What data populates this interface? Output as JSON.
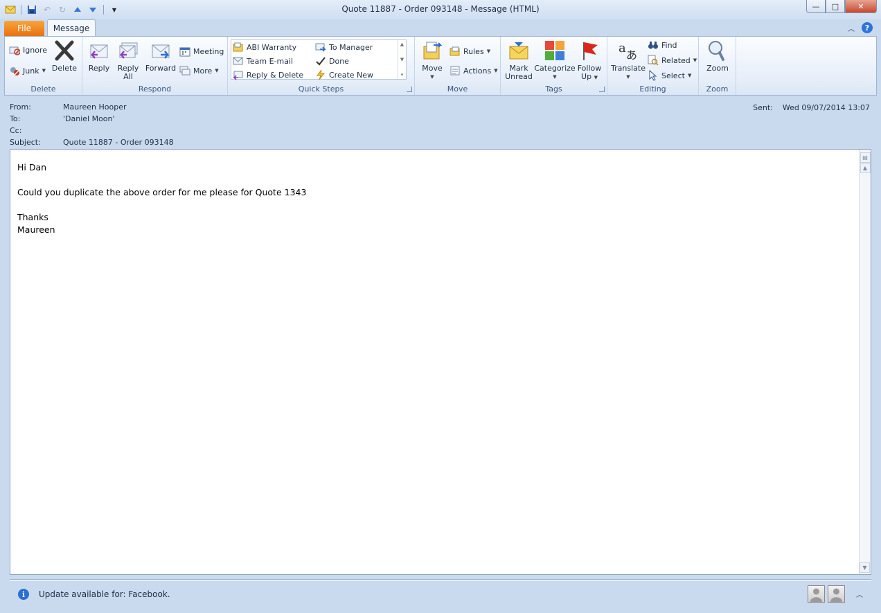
{
  "window": {
    "title": "Quote 11887 -  Order 093148  -  Message (HTML)",
    "controls": {
      "minimize": "—",
      "maximize": "□",
      "close": "✕"
    }
  },
  "quick_access": [
    "envelope-icon",
    "save-icon",
    "undo-icon",
    "redo-icon",
    "up-arrow-icon",
    "down-arrow-icon",
    "customize-icon"
  ],
  "tabs": {
    "file": "File",
    "message": "Message"
  },
  "ribbon": {
    "delete": {
      "label": "Delete",
      "ignore": "Ignore",
      "junk": "Junk",
      "delete": "Delete"
    },
    "respond": {
      "label": "Respond",
      "reply": "Reply",
      "reply_all_1": "Reply",
      "reply_all_2": "All",
      "forward": "Forward",
      "meeting": "Meeting",
      "more": "More"
    },
    "quick_steps": {
      "label": "Quick Steps",
      "items": [
        "ABI Warranty",
        "To Manager",
        "Team E-mail",
        "Done",
        "Reply & Delete",
        "Create New"
      ]
    },
    "move": {
      "label": "Move",
      "move": "Move",
      "rules": "Rules",
      "actions": "Actions"
    },
    "tags": {
      "label": "Tags",
      "mark_unread_1": "Mark",
      "mark_unread_2": "Unread",
      "categorize": "Categorize",
      "follow_up_1": "Follow",
      "follow_up_2": "Up"
    },
    "editing": {
      "label": "Editing",
      "translate": "Translate",
      "find": "Find",
      "related": "Related",
      "select": "Select"
    },
    "zoom": {
      "label": "Zoom",
      "zoom": "Zoom"
    }
  },
  "header": {
    "from_label": "From:",
    "from": "Maureen Hooper",
    "to_label": "To:",
    "to": "'Daniel Moon'",
    "cc_label": "Cc:",
    "cc": "",
    "subject_label": "Subject:",
    "subject": "Quote 11887 -  Order 093148",
    "sent_label": "Sent:",
    "sent": "Wed 09/07/2014 13:07"
  },
  "body": {
    "lines": [
      "Hi Dan",
      "",
      "Could you duplicate the above order for me please for Quote 1343",
      "",
      "Thanks",
      "Maureen"
    ]
  },
  "status": {
    "text": "Update available for: Facebook."
  },
  "colors": {
    "file_tab": "#e8720f",
    "ribbon_text": "#1e395b",
    "accent_blue": "#2c6fd1"
  }
}
